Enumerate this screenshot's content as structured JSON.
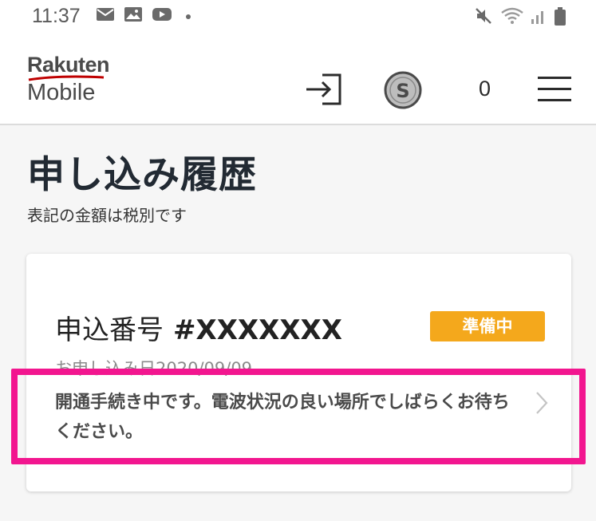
{
  "status_bar": {
    "time": "11:37",
    "icons": [
      "mail-icon",
      "image-icon",
      "youtube-icon",
      "notification-dot",
      "mute-icon",
      "wifi-icon",
      "signal-icon",
      "battery-icon"
    ]
  },
  "header": {
    "logo": {
      "line1": "Rakuten",
      "line2": "Mobile"
    },
    "icons": [
      "login-icon",
      "super-points-coin-icon",
      "menu-icon"
    ],
    "count": "0"
  },
  "page": {
    "title": "申し込み履歴",
    "subtitle": "表記の金額は税別です"
  },
  "order": {
    "number_label": "申込番号",
    "number_value": "#XXXXXXX",
    "status": "準備中",
    "status_color": "#f4a81c",
    "apply_date": "お申し込み日2020/09/09",
    "message": "開通手続き中です。電波状況の良い場所でしばらくお待ちください。"
  },
  "colors": {
    "highlight": "#f2168f",
    "background": "#f6f6f6"
  }
}
